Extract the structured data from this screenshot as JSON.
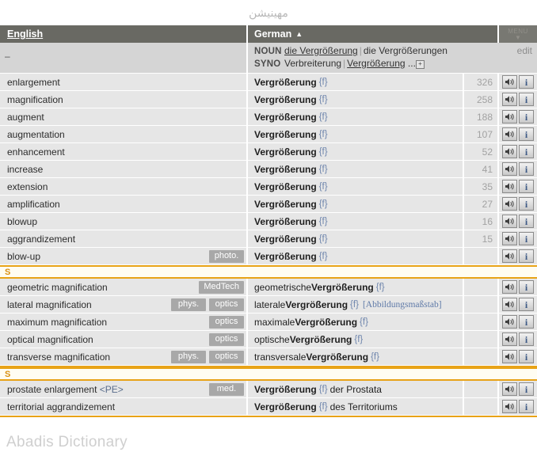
{
  "top": {
    "persian_word": "مهینیشن"
  },
  "header": {
    "english_label": "English",
    "german_label": "German",
    "sort_arrow": "▲",
    "menu_label": "MENU",
    "menu_chevron": "▼"
  },
  "headword": {
    "left_dash": "–",
    "edit_label": "edit",
    "noun_tag": "NOUN",
    "noun_singular": "die Vergrößerung",
    "noun_plural": "die Vergrößerungen",
    "syno_tag": "SYNO",
    "syno_first": "Verbreiterung",
    "syno_second": "Vergrößerung",
    "syno_ellipsis": "...",
    "expand_icon": "+",
    "pipe": "|"
  },
  "icons": {
    "audio": "speaker-icon",
    "info": "info-icon",
    "info_char": "i"
  },
  "sections": [
    {
      "marker": "",
      "rows": [
        {
          "en": "enlargement",
          "tags": [],
          "de_pre": "",
          "de": "Vergrößerung",
          "gender": "{f}",
          "de_post": "",
          "note": "",
          "count": "326"
        },
        {
          "en": "magnification",
          "tags": [],
          "de_pre": "",
          "de": "Vergrößerung",
          "gender": "{f}",
          "de_post": "",
          "note": "",
          "count": "258"
        },
        {
          "en": "augment",
          "tags": [],
          "de_pre": "",
          "de": "Vergrößerung",
          "gender": "{f}",
          "de_post": "",
          "note": "",
          "count": "188"
        },
        {
          "en": "augmentation",
          "tags": [],
          "de_pre": "",
          "de": "Vergrößerung",
          "gender": "{f}",
          "de_post": "",
          "note": "",
          "count": "107"
        },
        {
          "en": "enhancement",
          "tags": [],
          "de_pre": "",
          "de": "Vergrößerung",
          "gender": "{f}",
          "de_post": "",
          "note": "",
          "count": "52"
        },
        {
          "en": "increase",
          "tags": [],
          "de_pre": "",
          "de": "Vergrößerung",
          "gender": "{f}",
          "de_post": "",
          "note": "",
          "count": "41"
        },
        {
          "en": "extension",
          "tags": [],
          "de_pre": "",
          "de": "Vergrößerung",
          "gender": "{f}",
          "de_post": "",
          "note": "",
          "count": "35"
        },
        {
          "en": "amplification",
          "tags": [],
          "de_pre": "",
          "de": "Vergrößerung",
          "gender": "{f}",
          "de_post": "",
          "note": "",
          "count": "27"
        },
        {
          "en": "blowup",
          "tags": [],
          "de_pre": "",
          "de": "Vergrößerung",
          "gender": "{f}",
          "de_post": "",
          "note": "",
          "count": "16"
        },
        {
          "en": "aggrandizement",
          "tags": [],
          "de_pre": "",
          "de": "Vergrößerung",
          "gender": "{f}",
          "de_post": "",
          "note": "",
          "count": "15"
        },
        {
          "en": "blow-up",
          "tags": [
            "photo."
          ],
          "de_pre": "",
          "de": "Vergrößerung",
          "gender": "{f}",
          "de_post": "",
          "note": "",
          "count": ""
        }
      ]
    },
    {
      "marker": "S",
      "rows": [
        {
          "en": "geometric magnification",
          "tags": [
            "MedTech"
          ],
          "de_pre": "geometrische",
          "de": "Vergrößerung",
          "gender": "{f}",
          "de_post": "",
          "note": "",
          "count": ""
        },
        {
          "en": "lateral magnification",
          "tags": [
            "phys.",
            "optics"
          ],
          "de_pre": "laterale",
          "de": "Vergrößerung",
          "gender": "{f}",
          "de_post": "",
          "note": "[Abbildungsmaßstab]",
          "count": ""
        },
        {
          "en": "maximum magnification",
          "tags": [
            "optics"
          ],
          "de_pre": "maximale",
          "de": "Vergrößerung",
          "gender": "{f}",
          "de_post": "",
          "note": "",
          "count": ""
        },
        {
          "en": "optical magnification",
          "tags": [
            "optics"
          ],
          "de_pre": "optische",
          "de": "Vergrößerung",
          "gender": "{f}",
          "de_post": "",
          "note": "",
          "count": ""
        },
        {
          "en": "transverse magnification",
          "tags": [
            "phys.",
            "optics"
          ],
          "de_pre": "transversale",
          "de": "Vergrößerung",
          "gender": "{f}",
          "de_post": "",
          "note": "",
          "count": ""
        }
      ]
    },
    {
      "marker": "S",
      "rows": [
        {
          "en": "prostate enlargement <PE>",
          "tags": [
            "med."
          ],
          "de_pre": "",
          "de": "Vergrößerung",
          "gender": "{f}",
          "de_post": "der Prostata",
          "note": "",
          "count": ""
        },
        {
          "en": "territorial aggrandizement",
          "tags": [],
          "de_pre": "",
          "de": "Vergrößerung",
          "gender": "{f}",
          "de_post": "des Territoriums",
          "note": "",
          "count": ""
        }
      ]
    }
  ],
  "watermark": "Abadis Dictionary"
}
